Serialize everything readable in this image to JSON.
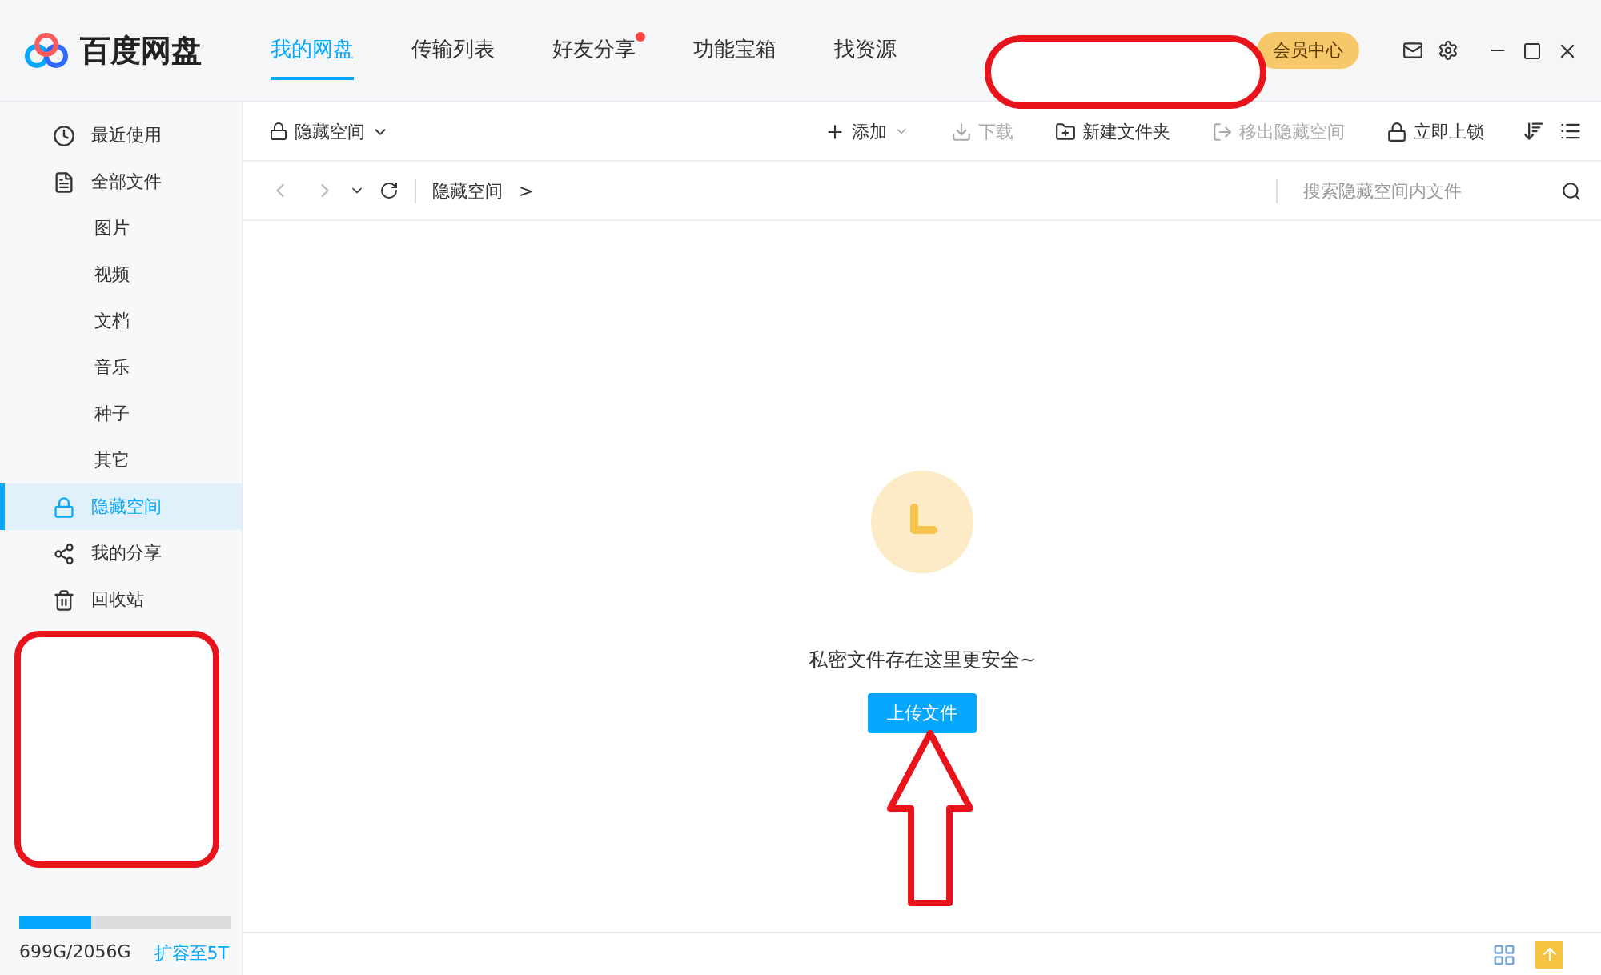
{
  "app": {
    "name": "百度网盘"
  },
  "tabs": [
    {
      "label": "我的网盘",
      "selected": true,
      "badge": false
    },
    {
      "label": "传输列表",
      "selected": false,
      "badge": false
    },
    {
      "label": "好友分享",
      "selected": false,
      "badge": true
    },
    {
      "label": "功能宝箱",
      "selected": false,
      "badge": false
    },
    {
      "label": "找资源",
      "selected": false,
      "badge": false
    }
  ],
  "member_button": "会员中心",
  "sidebar": {
    "items": [
      {
        "label": "最近使用",
        "kind": "main",
        "selected": false
      },
      {
        "label": "全部文件",
        "kind": "main",
        "selected": false
      },
      {
        "label": "图片",
        "kind": "sub",
        "selected": false
      },
      {
        "label": "视频",
        "kind": "sub",
        "selected": false
      },
      {
        "label": "文档",
        "kind": "sub",
        "selected": false
      },
      {
        "label": "音乐",
        "kind": "sub",
        "selected": false
      },
      {
        "label": "种子",
        "kind": "sub",
        "selected": false
      },
      {
        "label": "其它",
        "kind": "sub",
        "selected": false
      },
      {
        "label": "隐藏空间",
        "kind": "main",
        "selected": true
      },
      {
        "label": "我的分享",
        "kind": "main",
        "selected": false
      },
      {
        "label": "回收站",
        "kind": "main",
        "selected": false
      }
    ],
    "storage": {
      "level": 0.34,
      "used": "699G/2056G",
      "expand_link": "扩容至5T"
    }
  },
  "toolbar": {
    "space_menu": "隐藏空间",
    "actions": [
      {
        "label": "添加",
        "disabled": false,
        "menu": true
      },
      {
        "label": "下载",
        "disabled": true,
        "menu": false
      },
      {
        "label": "新建文件夹",
        "disabled": false,
        "menu": false
      },
      {
        "label": "移出隐藏空间",
        "disabled": true,
        "menu": false
      },
      {
        "label": "立即上锁",
        "disabled": false,
        "menu": false
      }
    ]
  },
  "nav": {
    "breadcrumb": [
      {
        "label": "隐藏空间",
        "separator": ">"
      }
    ],
    "search": {
      "placeholder": "搜索隐藏空间内文件"
    }
  },
  "empty_state": {
    "message": "私密文件存在这里更安全~",
    "button": "上传文件"
  }
}
